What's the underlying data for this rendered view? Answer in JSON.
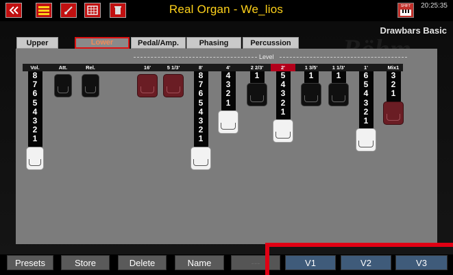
{
  "header": {
    "title": "Real Organ - We_lios",
    "clock": "20:25:35",
    "buttons": [
      {
        "name": "back-button",
        "icon": "double-chevron-left-icon"
      },
      {
        "name": "menu-button",
        "label": "MENU",
        "icon": "menu-icon"
      },
      {
        "name": "edit-button",
        "label": "EDIT",
        "icon": "edit-icon"
      },
      {
        "name": "edit-set-button",
        "label": "EDIT SET",
        "icon": "grid-icon"
      },
      {
        "name": "delete-button",
        "icon": "trash-icon"
      }
    ],
    "shift_label": "SHIFT"
  },
  "page": {
    "subtitle": "Drawbars Basic",
    "brand": "Böhm",
    "level_label": "Level"
  },
  "tabs": [
    {
      "label": "Upper",
      "active": false
    },
    {
      "label": "Lower",
      "active": true
    },
    {
      "label": "Pedal/Amp.",
      "active": false
    },
    {
      "label": "Phasing",
      "active": false
    },
    {
      "label": "Percussion",
      "active": false
    }
  ],
  "drawbars": [
    {
      "label": "Vol.",
      "value": 8,
      "color": "white"
    },
    {
      "label": "Att.",
      "value": 0,
      "color": "black"
    },
    {
      "label": "Rel.",
      "value": 0,
      "color": "black"
    },
    {
      "label": "16'",
      "value": 0,
      "color": "red"
    },
    {
      "label": "5 1/3'",
      "value": 0,
      "color": "red"
    },
    {
      "label": "8'",
      "value": 8,
      "color": "white"
    },
    {
      "label": "4'",
      "value": 4,
      "color": "white"
    },
    {
      "label": "2 2/3'",
      "value": 1,
      "color": "black"
    },
    {
      "label": "2'",
      "value": 5,
      "color": "white",
      "active": true
    },
    {
      "label": "1 3/5'",
      "value": 1,
      "color": "black"
    },
    {
      "label": "1 1/3'",
      "value": 1,
      "color": "black"
    },
    {
      "label": "1'",
      "value": 6,
      "color": "white"
    },
    {
      "label": "Mix1",
      "value": 3,
      "color": "red"
    }
  ],
  "footer": {
    "buttons": [
      "Presets",
      "Store",
      "Delete",
      "Name",
      "---",
      "V1",
      "V2",
      "V3"
    ]
  },
  "colors": {
    "title": "#ffd21a",
    "active_tab_border": "#dd1111",
    "active_column": "#b3001b",
    "highlight_frame": "#e00014"
  }
}
